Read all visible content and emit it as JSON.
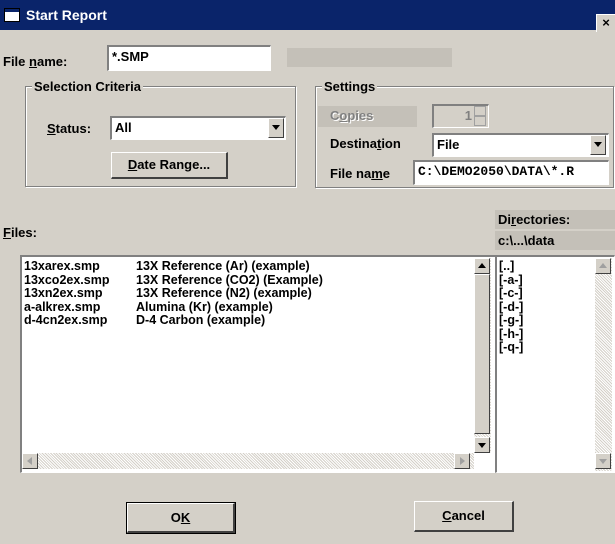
{
  "window": {
    "title": "Start Report",
    "close_glyph": "×"
  },
  "file_name": {
    "label": "File name:",
    "underline": "n",
    "value": "*.SMP"
  },
  "selection_criteria": {
    "title": "Selection Criteria",
    "status_label": "Status:",
    "status_value": "All",
    "date_range_label": "Date Range..."
  },
  "settings": {
    "title": "Settings",
    "copies_label": "Copies",
    "copies_value": "1",
    "destination_label": "Destination",
    "destination_value": "File",
    "file_name_label": "File name",
    "file_name_value": "C:\\DEMO2050\\DATA\\*.R"
  },
  "files": {
    "label": "Files:",
    "items": [
      {
        "name": "13xarex.smp",
        "desc": "13X Reference (Ar) (example)"
      },
      {
        "name": "13xco2ex.smp",
        "desc": "13X Reference (CO2) (Example)"
      },
      {
        "name": "13xn2ex.smp",
        "desc": "13X Reference (N2) (example)"
      },
      {
        "name": "a-alkrex.smp",
        "desc": "Alumina (Kr) (example)"
      },
      {
        "name": "d-4cn2ex.smp",
        "desc": "D-4 Carbon (example)"
      }
    ]
  },
  "directories": {
    "label": "Directories:",
    "path": "c:\\...\\data",
    "items": [
      "[..]",
      "[-a-]",
      "[-c-]",
      "[-d-]",
      "[-g-]",
      "[-h-]",
      "[-q-]"
    ]
  },
  "buttons": {
    "ok": "OK",
    "cancel": "Cancel"
  },
  "colors": {
    "titlebar": "#0a246a",
    "face": "#d4d0c8",
    "field": "#ffffff"
  }
}
